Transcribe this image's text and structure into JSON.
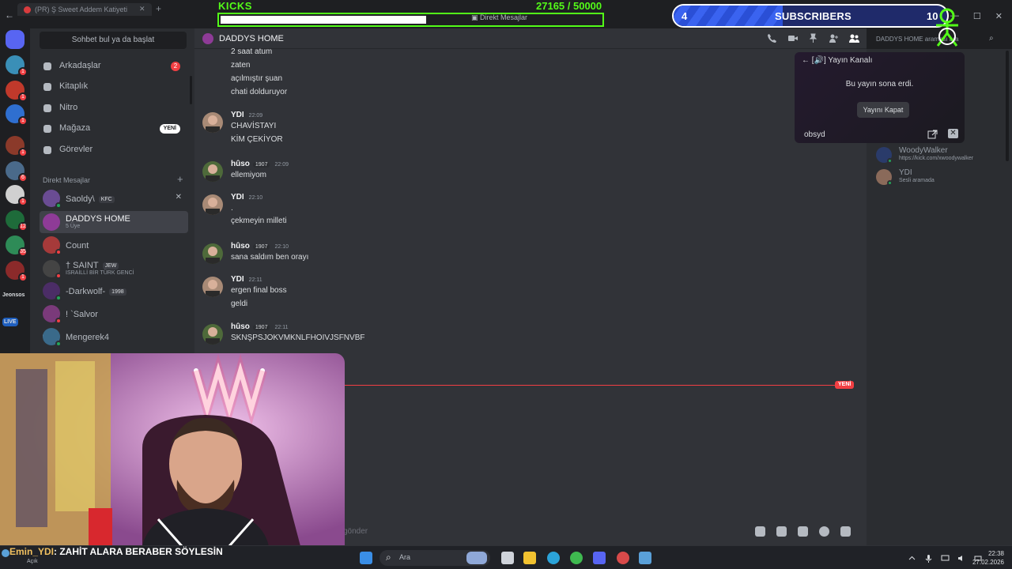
{
  "browser": {
    "tab_title": "(PR) Ş Sweet Addem Katiyeti",
    "nav_back": "←"
  },
  "window_controls": [
    "—",
    "☐",
    "✕"
  ],
  "overlays": {
    "kicks": {
      "label": "KICKS",
      "count": "27165 / 50000",
      "progress": 0.54,
      "caption": "Direkt Mesajlar",
      "color": "#53fc18"
    },
    "subscribers": {
      "count": "4",
      "label": "SUBSCRIBERS",
      "goal": "10",
      "progress": 0.4,
      "color": "#2a4fd6"
    }
  },
  "server_rail": {
    "servers": [
      {
        "icon": "discord-home-icon",
        "color": "#5865f2",
        "badge": ""
      },
      {
        "icon": "server-avatar",
        "color": "#3a8fb7",
        "badge": "1"
      },
      {
        "icon": "server-avatar",
        "color": "#c0392b",
        "badge": "1"
      },
      {
        "icon": "server-avatar",
        "color": "#2f6fd0",
        "badge": "1"
      },
      {
        "icon": "server-avatar",
        "color": "#8b3a2a",
        "badge": "1"
      },
      {
        "icon": "server-avatar",
        "color": "#4a6a8a",
        "badge": "6"
      },
      {
        "icon": "server-avatar",
        "color": "#d0d0d0",
        "badge": "1"
      },
      {
        "icon": "server-avatar",
        "color": "#1e6b3a",
        "badge": "12"
      },
      {
        "icon": "server-avatar",
        "color": "#2e8b57",
        "badge": "35"
      },
      {
        "icon": "server-avatar",
        "color": "#8b2a2a",
        "badge": "1"
      }
    ],
    "labels": [
      "Jeonsos",
      "LIVE"
    ]
  },
  "dm_sidebar": {
    "search_placeholder": "Sohbet bul ya da başlat",
    "nav": [
      {
        "label": "Arkadaşlar",
        "icon": "friends-icon",
        "badge": "2"
      },
      {
        "label": "Kitaplık",
        "icon": "library-icon",
        "badge": ""
      },
      {
        "label": "Nitro",
        "icon": "nitro-icon",
        "badge": ""
      },
      {
        "label": "Mağaza",
        "icon": "shop-icon",
        "badge": "YENİ"
      },
      {
        "label": "Görevler",
        "icon": "quests-icon",
        "badge": ""
      }
    ],
    "header": "Direkt Mesajlar",
    "add": "+",
    "dms": [
      {
        "name": "Saoldy\\",
        "tag": "KFC",
        "sub": "",
        "color": "#6a4c93",
        "status": "#23a55a",
        "close": "✕"
      },
      {
        "name": "DADDYS HOME",
        "tag": "",
        "sub": "5 Üye",
        "color": "#8e3b97",
        "status": "",
        "close": ""
      },
      {
        "name": "Count",
        "tag": "",
        "sub": "",
        "color": "#a63a3a",
        "status": "#f23f43",
        "close": ""
      },
      {
        "name": "† SAINT",
        "tag": "JEW",
        "sub": "ISRAİLLİ BİR TÜRK GENCİ",
        "color": "#444",
        "status": "#f23f43",
        "close": ""
      },
      {
        "name": "-Darkwolf-",
        "tag": "1998",
        "sub": "",
        "color": "#4b2d66",
        "status": "#23a55a",
        "close": ""
      },
      {
        "name": "! `Salvor",
        "tag": "",
        "sub": "",
        "color": "#7a3a7a",
        "status": "#f23f43",
        "close": ""
      },
      {
        "name": "Mengerek4",
        "tag": "",
        "sub": "",
        "color": "#3a6a8a",
        "status": "#23a55a",
        "close": ""
      }
    ]
  },
  "chat": {
    "channel": "DADDYS HOME",
    "search_placeholder": "DADDYS HOME araması ara",
    "messages": [
      {
        "author": "",
        "time": "",
        "role": "",
        "lines": [
          "2 saat atum",
          "zaten",
          "açılmıştır şuan",
          "chati dolduruyor"
        ]
      },
      {
        "author": "YDI",
        "time": "22:09",
        "role": "",
        "lines": [
          "CHAVİSTAYI",
          "KİM ÇEKİYOR"
        ]
      },
      {
        "author": "hûso",
        "time": "22:09",
        "role": "1907",
        "lines": [
          "ellemiyom"
        ]
      },
      {
        "author": "YDI",
        "time": "22:10",
        "role": "",
        "lines": [
          ".",
          "çekmeyin milleti"
        ]
      },
      {
        "author": "hûso",
        "time": "22:10",
        "role": "1907",
        "lines": [
          "sana saldım  ben orayı"
        ]
      },
      {
        "author": "YDI",
        "time": "22:11",
        "role": "",
        "lines": [
          "ergen final boss",
          "geldi"
        ]
      },
      {
        "author": "hûso",
        "time": "22:11",
        "role": "1907",
        "lines": [
          "SKNŞPSJOKVMKNLFHOIVJSFNVBF"
        ]
      }
    ],
    "new_marker": "YENİ",
    "composer_placeholder": "gönder"
  },
  "stream_panel": {
    "back_label": "[🔊] Yayın Kanalı",
    "ended_text": "Bu yayın sona erdi.",
    "close_button": "Yayını Kapat",
    "user": "obsyd",
    "close_icon": "✕"
  },
  "members": [
    {
      "name": "WoodyWalker",
      "activity": "https://kick.com/xwoodywalker",
      "color": "#2a3b6a",
      "status": "#23a55a"
    },
    {
      "name": "YDI",
      "activity": "Sesli aramada",
      "color": "#8a6a5a",
      "status": "#23a55a"
    }
  ],
  "taskbar": {
    "chat_user": "Emin_YDI",
    "chat_text": ": ZAHİT ALARA BERABER SÖYLESİN",
    "left_sub": "Açık",
    "search": "Ara",
    "time": "22:38",
    "date": "27.02.2026",
    "apps": [
      {
        "icon": "windows-start-icon",
        "color": "#3a8ee6"
      },
      {
        "icon": "task-view-icon",
        "color": "#cfd3da"
      },
      {
        "icon": "file-explorer-icon",
        "color": "#f2c230"
      },
      {
        "icon": "edge-icon",
        "color": "#2ba3d9"
      },
      {
        "icon": "upwork-icon",
        "color": "#3fb950"
      },
      {
        "icon": "discord-icon",
        "color": "#5865f2"
      },
      {
        "icon": "record-icon",
        "color": "#d84a4a"
      },
      {
        "icon": "steam-icon",
        "color": "#5aa0d8"
      }
    ]
  }
}
